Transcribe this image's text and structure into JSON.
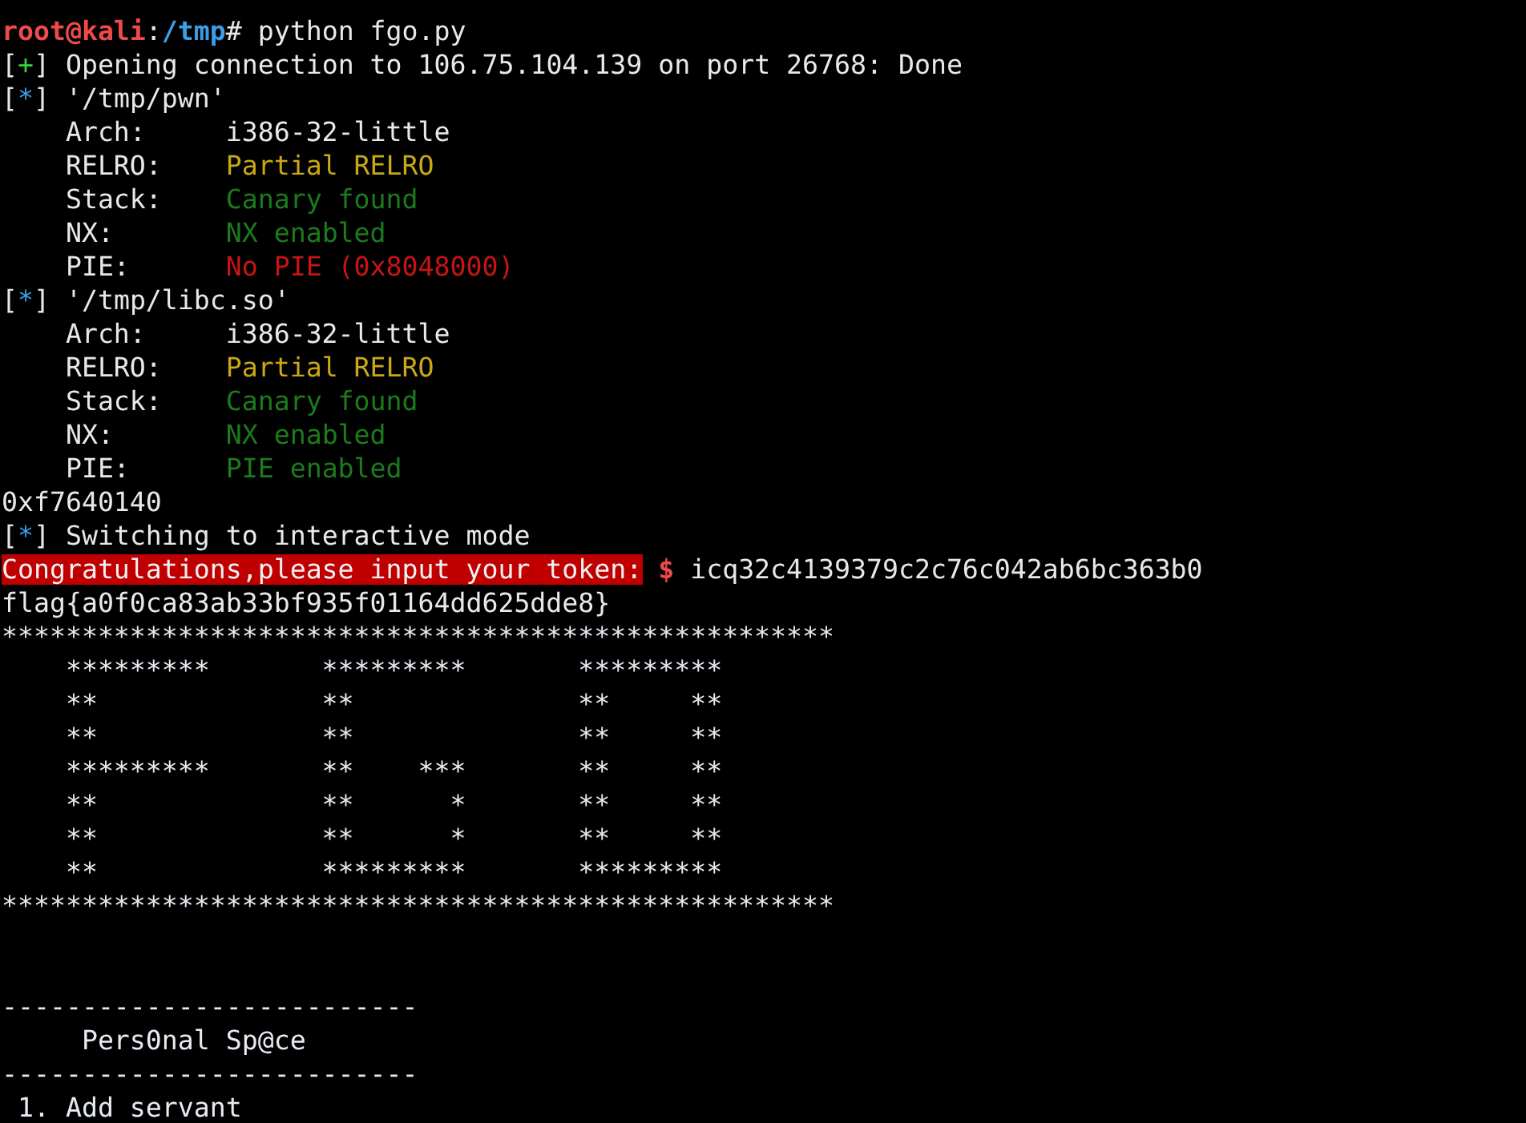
{
  "terminal": {
    "lines": [
      {
        "segments": [
          {
            "text": "root@kali",
            "color": "#ef4a4a",
            "bold": true
          },
          {
            "text": ":"
          },
          {
            "text": "/tmp",
            "color": "#3b9ee6",
            "bold": true
          },
          {
            "text": "# python fgo.py"
          }
        ]
      },
      {
        "segments": [
          {
            "text": "["
          },
          {
            "text": "+",
            "color": "#3ccf3c"
          },
          {
            "text": "] Opening connection to 106.75.104.139 on port 26768: Done"
          }
        ]
      },
      {
        "segments": [
          {
            "text": "["
          },
          {
            "text": "*",
            "color": "#3b9ee6"
          },
          {
            "text": "] '/tmp/pwn'"
          }
        ]
      },
      {
        "segments": [
          {
            "text": "    Arch:     i386-32-little"
          }
        ]
      },
      {
        "segments": [
          {
            "text": "    RELRO:    "
          },
          {
            "text": "Partial RELRO",
            "color": "#c8a814"
          }
        ]
      },
      {
        "segments": [
          {
            "text": "    Stack:    "
          },
          {
            "text": "Canary found",
            "color": "#1d7a1d"
          }
        ]
      },
      {
        "segments": [
          {
            "text": "    NX:       "
          },
          {
            "text": "NX enabled",
            "color": "#1d7a1d"
          }
        ]
      },
      {
        "segments": [
          {
            "text": "    PIE:      "
          },
          {
            "text": "No PIE (0x8048000)",
            "color": "#c81414"
          }
        ]
      },
      {
        "segments": [
          {
            "text": "["
          },
          {
            "text": "*",
            "color": "#3b9ee6"
          },
          {
            "text": "] '/tmp/libc.so'"
          }
        ]
      },
      {
        "segments": [
          {
            "text": "    Arch:     i386-32-little"
          }
        ]
      },
      {
        "segments": [
          {
            "text": "    RELRO:    "
          },
          {
            "text": "Partial RELRO",
            "color": "#c8a814"
          }
        ]
      },
      {
        "segments": [
          {
            "text": "    Stack:    "
          },
          {
            "text": "Canary found",
            "color": "#1d7a1d"
          }
        ]
      },
      {
        "segments": [
          {
            "text": "    NX:       "
          },
          {
            "text": "NX enabled",
            "color": "#1d7a1d"
          }
        ]
      },
      {
        "segments": [
          {
            "text": "    PIE:      "
          },
          {
            "text": "PIE enabled",
            "color": "#1d7a1d"
          }
        ]
      },
      {
        "segments": [
          {
            "text": "0xf7640140"
          }
        ]
      },
      {
        "segments": [
          {
            "text": "["
          },
          {
            "text": "*",
            "color": "#3b9ee6"
          },
          {
            "text": "] Switching to interactive mode"
          }
        ]
      },
      {
        "segments": [
          {
            "text": "Congratulations,please input your token:",
            "highlighted": true
          },
          {
            "text": " $",
            "color": "#ef4a4a",
            "bold": true
          },
          {
            "text": " icq32c4139379c2c76c042ab6bc363b0"
          }
        ]
      },
      {
        "segments": [
          {
            "text": "flag{a0f0ca83ab33bf935f01164dd625dde8}"
          }
        ]
      }
    ],
    "banner": "****************************************************\n    *********       *********       *********\n    **              **              **     **\n    **              **              **     **\n    *********       **    ***       **     **\n    **              **      *       **     **\n    **              **      *       **     **\n    **              *********       *********\n****************************************************",
    "menu": [
      "--------------------------",
      "     Pers0nal Sp@ce",
      "--------------------------",
      " 1. Add servant"
    ]
  }
}
